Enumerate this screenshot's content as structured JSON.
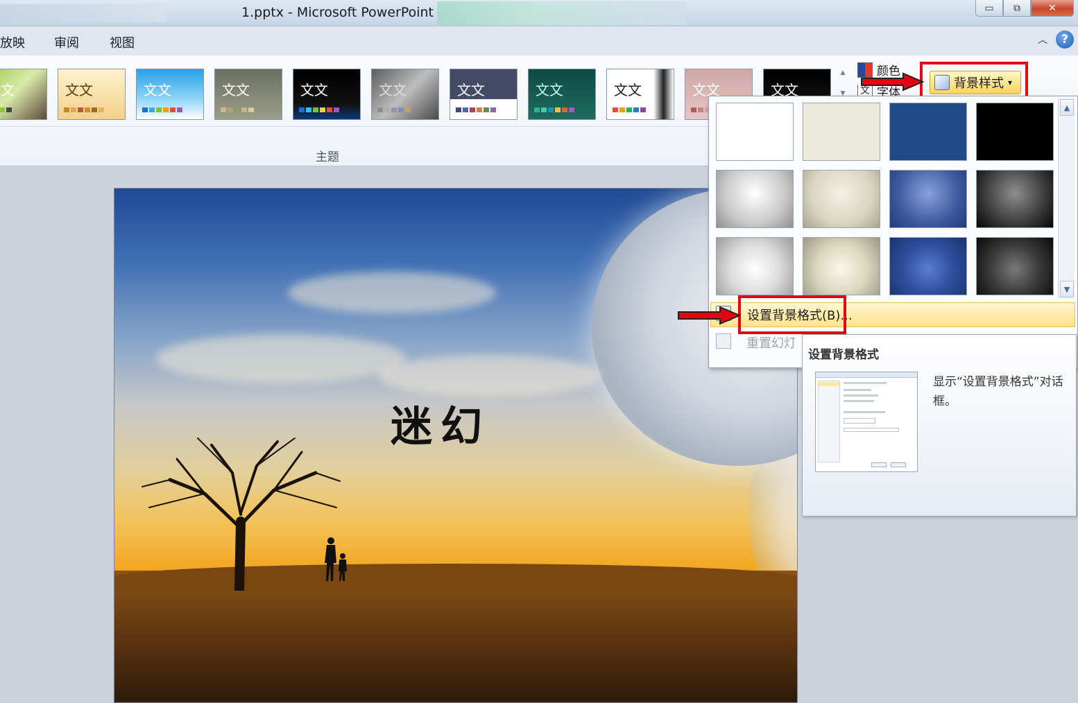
{
  "window": {
    "title": "1.pptx  -  Microsoft PowerPoint",
    "minimize_glyph": "▭",
    "restore_glyph": "⧉",
    "close_glyph": "✕"
  },
  "menu": {
    "tabs": [
      "放映",
      "审阅",
      "视图"
    ],
    "help_glyph": "?",
    "collapse_glyph": "︿"
  },
  "ribbon": {
    "group_label": "主题",
    "themes": [
      {
        "sample": "文文",
        "bg": "linear-gradient(135deg,#9ac84a,#d9e9a8 50%,#5b4a3a)",
        "fg": "#fff",
        "swatches": [
          "#e2582b",
          "#f4b400",
          "#8cc63f",
          "#444"
        ]
      },
      {
        "sample": "文文",
        "bg": "linear-gradient(#fff1cc,#f2d08a)",
        "fg": "#5a3a10",
        "swatches": [
          "#c9862b",
          "#e2a650",
          "#b5573b",
          "#d88b2a",
          "#9b6b2a",
          "#e9b35e"
        ]
      },
      {
        "sample": "文文",
        "bg": "linear-gradient(#2aa0e6,#8fd5f7 60%,#fff)",
        "fg": "#fff",
        "swatches": [
          "#1e6fd0",
          "#3aa8e0",
          "#7bc043",
          "#f39c12",
          "#e74c3c",
          "#9b59b6"
        ]
      },
      {
        "sample": "文文",
        "bg": "linear-gradient(#6b7060,#9a9e88)",
        "fg": "#fff",
        "swatches": [
          "#c7b98d",
          "#a9a27a",
          "#8f9a73",
          "#bfb59a",
          "#d9c9a0"
        ]
      },
      {
        "sample": "文文",
        "bg": "linear-gradient(#000,#111 70%,#0b3a7a)",
        "fg": "#fff",
        "swatches": [
          "#1e6fd0",
          "#2dc3f0",
          "#7bc043",
          "#f4d03f",
          "#e74c3c",
          "#9b59b6"
        ]
      },
      {
        "sample": "文文",
        "bg": "linear-gradient(135deg,#5c5c5c,#bdbdbd 50%,#4a4a4a)",
        "fg": "#ddd",
        "swatches": [
          "#8e8e8e",
          "#b0b0b0",
          "#9c8fb0",
          "#7d8fb0",
          "#c0a070"
        ]
      },
      {
        "sample": "文文",
        "bg": "linear-gradient(#454a66 60%,#ffffff 60%)",
        "fg": "#fff",
        "swatches": [
          "#3a4a7a",
          "#5468a0",
          "#b04050",
          "#d08040",
          "#6a8a50",
          "#8a6aa0"
        ]
      },
      {
        "sample": "文文",
        "bg": "linear-gradient(#0e4a44,#1f6b5d)",
        "fg": "#cfe",
        "swatches": [
          "#2db38a",
          "#48c7b0",
          "#1e90c0",
          "#f0c040",
          "#e06040",
          "#a060c0"
        ]
      },
      {
        "sample": "文文",
        "bg": "linear-gradient(90deg,#fff 70%,#222 85%,#fff)",
        "fg": "#222",
        "swatches": [
          "#e74c3c",
          "#f39c12",
          "#27ae60",
          "#2980b9",
          "#8e44ad"
        ]
      },
      {
        "sample": "文文",
        "bg": "linear-gradient(#cfa7a7,#e3c6c6)",
        "fg": "#fff",
        "swatches": [
          "#b05a5a",
          "#c98080",
          "#d9a0a0",
          "#a04848"
        ]
      },
      {
        "sample": "文文",
        "bg": "linear-gradient(#000,#1a1a1a)",
        "fg": "#fff",
        "swatches": [
          "#444",
          "#666",
          "#888"
        ]
      }
    ],
    "colors_label": "颜色",
    "fonts_label": "字体",
    "bg_style_label": "背景样式",
    "bg_style_caret": "▾",
    "scroll_up": "▲",
    "scroll_down": "▼"
  },
  "slide": {
    "title": "迷幻"
  },
  "dropdown": {
    "swatches": [
      {
        "fill": "#ffffff"
      },
      {
        "fill": "#ece9dd"
      },
      {
        "fill": "#1f4a86"
      },
      {
        "fill": "#000000"
      },
      {
        "fill": "radial-gradient(circle at 50% 40%, #ffffff, #c8c8c8 60%, #8f8f8f)"
      },
      {
        "fill": "radial-gradient(circle at 50% 40%, #f4f1e4, #d9d4bd 60%, #a7a38c)"
      },
      {
        "fill": "radial-gradient(circle at 50% 40%, #8aa1da, #3e5a9e 60%, #223a78)"
      },
      {
        "fill": "radial-gradient(circle at 50% 40%, #8e8e8e, #3b3b3b 60%, #050505)"
      },
      {
        "fill": "radial-gradient(circle at 50% 55%, #ffffff, #dcdcdc 50%, #9a9a9a)"
      },
      {
        "fill": "radial-gradient(circle at 50% 55%, #fbf8ea, #dcd7bf 50%, #9d9883)"
      },
      {
        "fill": "radial-gradient(circle at 50% 55%, #5a7ed0, #2f4f9e 50%, #1a3272)"
      },
      {
        "fill": "radial-gradient(circle at 50% 55%, #7a7a7a, #3a3a3a 50%, #0a0a0a)"
      }
    ],
    "format_bg_item": "设置背景格式(B)...",
    "reset_item": "重置幻灯片背景(A)"
  },
  "tooltip": {
    "title": "设置背景格式",
    "description": "显示“设置背景格式”对话框。"
  },
  "annotation_color": "#e60012"
}
